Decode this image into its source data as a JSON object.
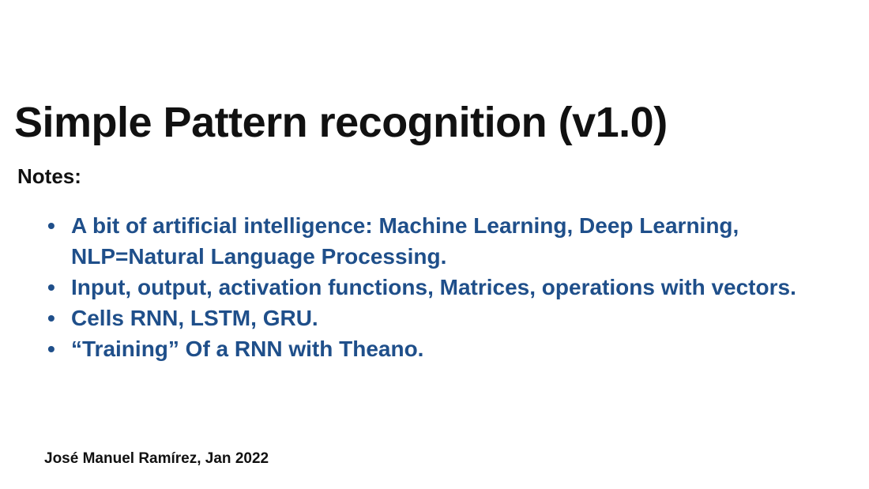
{
  "slide": {
    "title": "Simple Pattern recognition (v1.0)",
    "notes_label": "Notes:",
    "bullet_symbol": "•",
    "bullets": [
      "A bit of artificial intelligence: Machine Learning, Deep Learning, NLP=Natural Language Processing.",
      "Input, output, activation functions, Matrices, operations with vectors.",
      "Cells RNN, LSTM, GRU.",
      "“Training” Of a RNN with Theano."
    ],
    "author": "José Manuel Ramírez, Jan 2022"
  },
  "colors": {
    "title": "#111111",
    "bullet_text": "#1f4f8a",
    "background": "#ffffff"
  }
}
